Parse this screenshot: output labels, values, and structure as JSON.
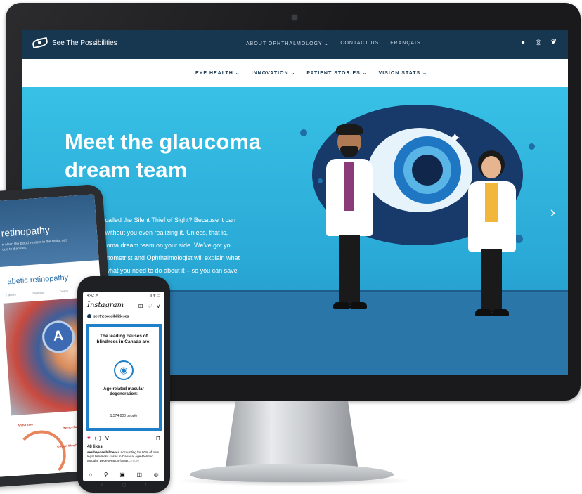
{
  "desktop": {
    "logo_text": "See The Possibilities",
    "top_nav": [
      {
        "label": "ABOUT OPHTHALMOLOGY ⌄"
      },
      {
        "label": "CONTACT US"
      },
      {
        "label": "FRANÇAIS"
      }
    ],
    "social_icons": [
      "facebook-icon",
      "instagram-icon",
      "twitter-icon"
    ],
    "sub_nav": [
      {
        "label": "EYE HEALTH ⌄"
      },
      {
        "label": "INNOVATION ⌄"
      },
      {
        "label": "PATIENT STORIES ⌄"
      },
      {
        "label": "VISION STATS ⌄"
      }
    ],
    "hero": {
      "title": "Meet the glaucoma dream team",
      "body_lines": [
        "a called the Silent Thief of Sight? Because it can",
        "n without you even realizing it. Unless, that is,",
        "ucoma dream team on your side. We've got you",
        "Optometrist and Ophthalmologist will explain what",
        "d what you need to do about it – so you can save"
      ],
      "next_arrow": "›"
    }
  },
  "tablet": {
    "banner_title": "retinopathy",
    "banner_small": "n when the blood vessels in the retina ges due to diabetes.",
    "section_heading": "abetic retinopathy",
    "tabs": [
      "k factors",
      "Diagnosis",
      "Treatm"
    ],
    "shield_letter": "A",
    "diagram_labels": {
      "aneurysm": "Aneurysm",
      "hemorrhages": "Hemorrhages",
      "cotton_wool": "\"Cotton Wool\" Spots"
    }
  },
  "phone": {
    "time": "4:42 ⇗",
    "status_icons": "ıl ᯤ ▭",
    "app_name": "Instagram",
    "account": "seethepossibilitiesca",
    "post": {
      "title": "The leading causes of blindness in Canada are:",
      "condition": "Age-related macular degeneration:",
      "count": "1,574,000 people"
    },
    "likes": "48 likes",
    "caption_user": "seethepossibilitiesca",
    "caption_text": " Accounting for 90% of new legal blindness cases in Canada, Age-Related Macular Degeneration (AMD... ",
    "caption_more": "more"
  },
  "colors": {
    "nav_dark": "#173650",
    "hero_blue": "#2fb8de",
    "instagram_blue": "#1f7fc8"
  }
}
